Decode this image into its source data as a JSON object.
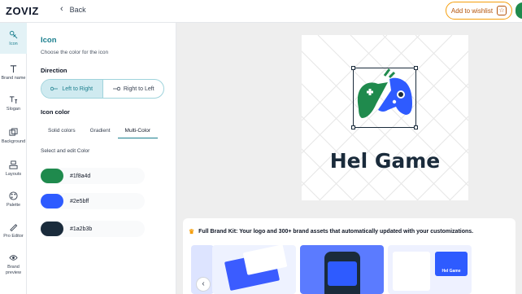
{
  "header": {
    "logo": "ZOVIZ",
    "back_label": "Back",
    "wishlist_label": "Add to wishlist"
  },
  "rail": {
    "items": [
      {
        "label": "Icon",
        "icon": "icon-icon"
      },
      {
        "label": "Brand name",
        "icon": "text-icon"
      },
      {
        "label": "Slogan",
        "icon": "slogan-icon"
      },
      {
        "label": "Background",
        "icon": "background-icon"
      },
      {
        "label": "Layouts",
        "icon": "layouts-icon"
      },
      {
        "label": "Palette",
        "icon": "palette-icon"
      },
      {
        "label": "Pro Editor",
        "icon": "pro-editor-icon"
      },
      {
        "label": "Brand preview",
        "icon": "eye-icon"
      }
    ]
  },
  "panel": {
    "title": "Icon",
    "subtitle": "Choose the color for the icon",
    "direction_label": "Direction",
    "direction_options": [
      "Left to Right",
      "Right to Left"
    ],
    "direction_selected": "Left to Right",
    "icon_color_label": "Icon color",
    "color_tabs": [
      "Solid colors",
      "Gradient",
      "Multi-Color"
    ],
    "color_tab_selected": "Multi-Color",
    "select_label": "Select and edit Color",
    "colors": [
      "#1f8a4d",
      "#2e5bff",
      "#1a2b3b"
    ]
  },
  "preview": {
    "brand_name": "Hel Game",
    "watermark": "zoviz"
  },
  "kit": {
    "heading": "Full Brand Kit: Your logo and 300+ brand assets that automatically updated with your customizations.",
    "mock_brand": "Hel Game"
  },
  "colors": {
    "accent": "#1b7f8e",
    "green": "#1f8a4d",
    "blue": "#2e5bff",
    "dark": "#1a2b3b",
    "wishlist": "#f59e0b"
  }
}
